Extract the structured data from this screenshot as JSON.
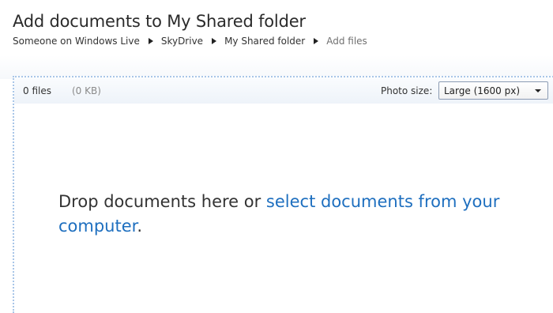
{
  "page": {
    "title": "Add documents to My Shared folder"
  },
  "breadcrumb": {
    "items": [
      {
        "label": "Someone on Windows Live"
      },
      {
        "label": "SkyDrive"
      },
      {
        "label": "My Shared folder"
      },
      {
        "label": "Add files"
      }
    ]
  },
  "toolbar": {
    "file_count": "0 files",
    "file_size": "(0 KB)",
    "photo_size_label": "Photo size:",
    "photo_size_value": "Large (1600 px)"
  },
  "dropzone": {
    "message_prefix": "Drop documents here or ",
    "link_text": "select documents from your computer",
    "message_suffix": "."
  },
  "colors": {
    "link": "#1e6fbf",
    "dropzone_border": "#a9c6e8"
  },
  "icons": {
    "breadcrumb_separator": "triangle-right-icon",
    "dropdown_arrow": "chevron-down-icon"
  }
}
